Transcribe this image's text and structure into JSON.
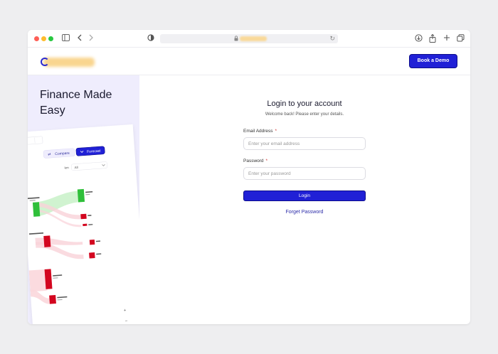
{
  "header": {
    "demo_label": "Book a Demo"
  },
  "hero": {
    "title": "Finance Made Easy"
  },
  "mockup": {
    "compare_label": "Compare",
    "forecast_label": "Forecast",
    "filter_label": "km",
    "filter_value": "All",
    "zoom_in": "+",
    "zoom_out": "−"
  },
  "login": {
    "title": "Login to your account",
    "subtitle": "Welcome back! Please enter your details.",
    "email_label": "Email Address",
    "email_placeholder": "Enter your email address",
    "password_label": "Password",
    "password_placeholder": "Enter your password",
    "required_mark": "*",
    "submit_label": "Login",
    "forgot_label": "Forget Password"
  },
  "colors": {
    "accent": "#2020d6",
    "panel_bg": "#efedfd",
    "flow_green": "#2fbf3a",
    "flow_red": "#d3061f"
  }
}
